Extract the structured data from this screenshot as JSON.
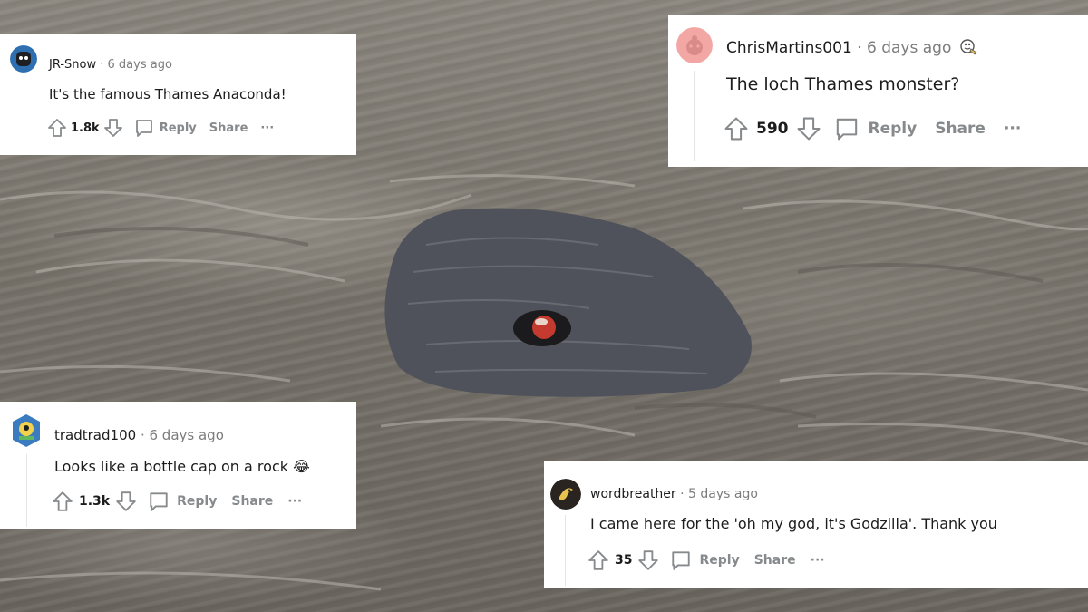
{
  "scene": {
    "background": "river-water-photo",
    "subject": "rock-with-bottle-cap",
    "colors": {
      "water": "#7a766e",
      "rock": "#4f525a",
      "cap": "#c43a2e"
    }
  },
  "ui": {
    "colors": {
      "card": "#ffffff",
      "text": "#1c1c1c",
      "muted": "#7c7c7c",
      "action": "#878a8c"
    },
    "icons": [
      "upvote-icon",
      "downvote-icon",
      "comment-icon",
      "more-icon",
      "award-icon",
      "emoji-icon"
    ]
  },
  "comments": [
    {
      "username": "JR-Snow",
      "separator": "·",
      "time": "6 days ago",
      "body": "It's the famous Thames Anaconda!",
      "score": "1.8k",
      "reply_label": "Reply",
      "share_label": "Share",
      "more_label": "···"
    },
    {
      "username": "ChrisMartins001",
      "separator": "·",
      "time": "6 days ago",
      "body": "The loch Thames monster?",
      "score": "590",
      "reply_label": "Reply",
      "share_label": "Share",
      "more_label": "···"
    },
    {
      "username": "tradtrad100",
      "separator": "·",
      "time": "6 days ago",
      "body": "Looks like a bottle cap on a rock",
      "emoji": "😂",
      "score": "1.3k",
      "reply_label": "Reply",
      "share_label": "Share",
      "more_label": "···"
    },
    {
      "username": "wordbreather",
      "separator": "·",
      "time": "5 days ago",
      "body": "I came here for the 'oh my god, it's Godzilla'. Thank you",
      "score": "35",
      "reply_label": "Reply",
      "share_label": "Share",
      "more_label": "···"
    }
  ]
}
